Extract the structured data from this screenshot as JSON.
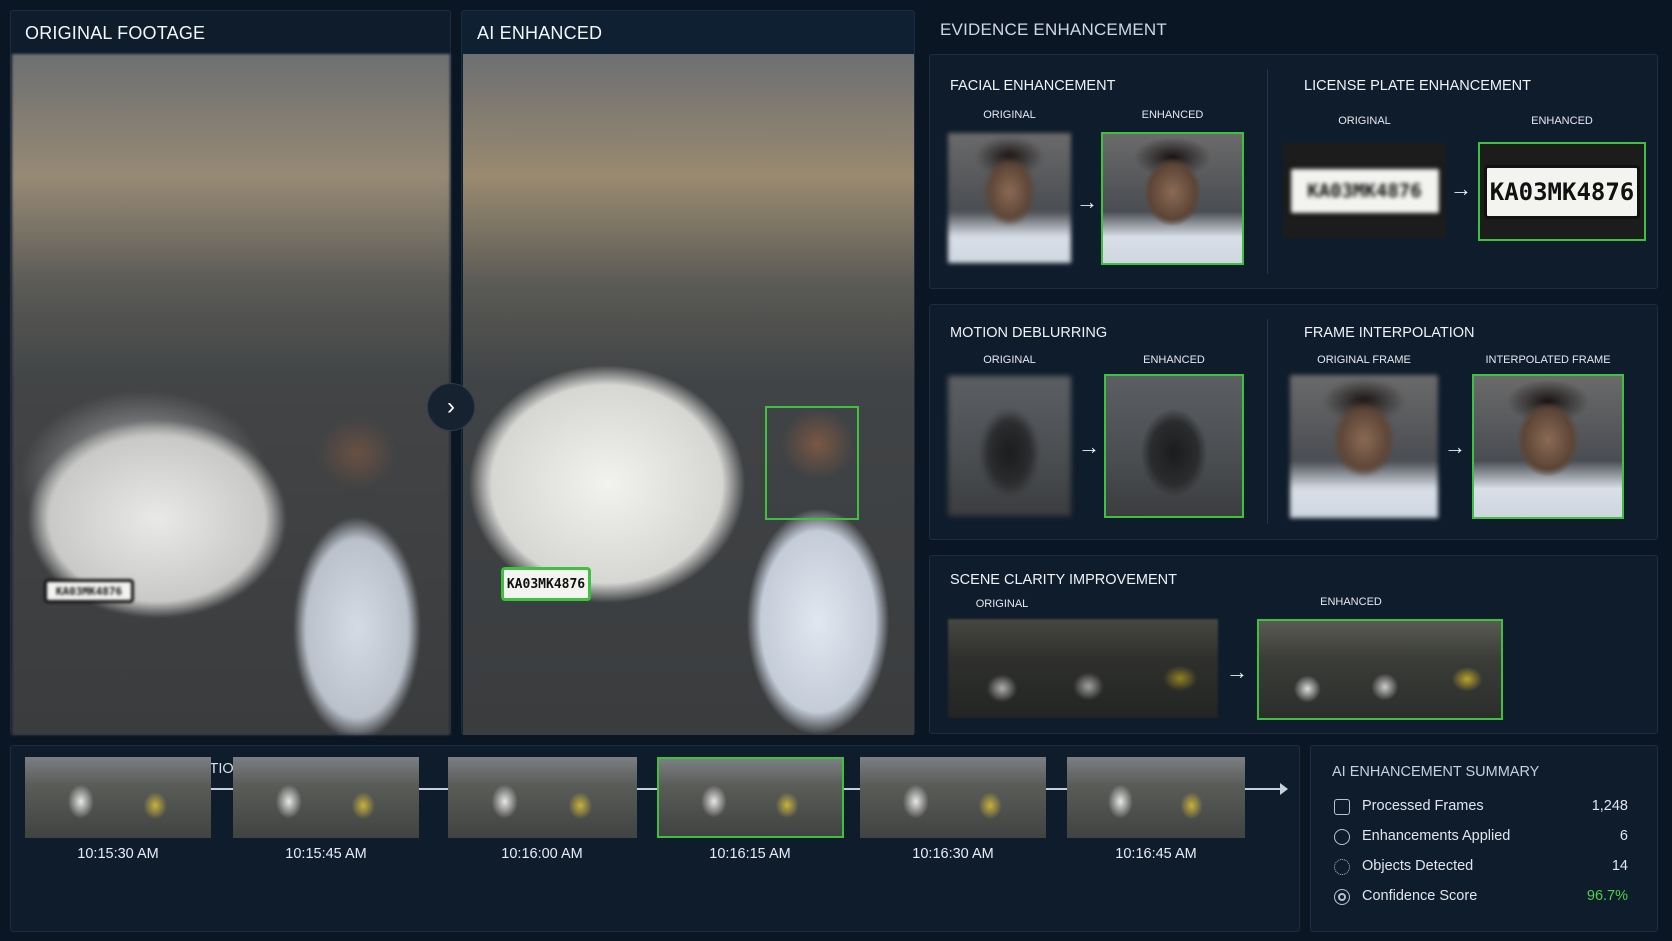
{
  "original_panel": {
    "title": "ORIGINAL FOOTAGE",
    "plate_text": "KA03MK4876"
  },
  "enhanced_panel": {
    "title": "AI ENHANCED",
    "plate_text": "KA03MK4876"
  },
  "evidence": {
    "title": "EVIDENCE ENHANCEMENT",
    "facial": {
      "title": "FACIAL ENHANCEMENT",
      "original_label": "ORIGINAL",
      "enhanced_label": "ENHANCED"
    },
    "plate": {
      "title": "LICENSE PLATE ENHANCEMENT",
      "original_label": "ORIGINAL",
      "enhanced_label": "ENHANCED",
      "original_text": "KA03MK4876",
      "enhanced_text": "KA03MK4876"
    },
    "motion": {
      "title": "MOTION DEBLURRING",
      "original_label": "ORIGINAL",
      "enhanced_label": "ENHANCED"
    },
    "interp": {
      "title": "FRAME INTERPOLATION",
      "original_label": "ORIGINAL FRAME",
      "enhanced_label": "INTERPOLATED FRAME"
    },
    "scene": {
      "title": "SCENE CLARITY IMPROVEMENT",
      "original_label": "ORIGINAL",
      "enhanced_label": "ENHANCED"
    }
  },
  "timeline": {
    "title": "TIMELINE FRAME EXTRACTION",
    "frames": [
      "10:15:30 AM",
      "10:15:45 AM",
      "10:16:00 AM",
      "10:16:15 AM",
      "10:16:30 AM",
      "10:16:45 AM"
    ],
    "selected_index": 3
  },
  "summary": {
    "title": "AI ENHANCEMENT SUMMARY",
    "rows": [
      {
        "label": "Processed Frames",
        "value": "1,248",
        "icon": "frames-icon"
      },
      {
        "label": "Enhancements Applied",
        "value": "6",
        "icon": "enhance-icon"
      },
      {
        "label": "Objects Detected",
        "value": "14",
        "icon": "objects-icon"
      },
      {
        "label": "Confidence Score",
        "value": "96.7%",
        "icon": "confidence-icon"
      }
    ]
  },
  "colors": {
    "accent": "#3ec13e",
    "background": "#0b1624",
    "panel": "#0f1c2b"
  }
}
